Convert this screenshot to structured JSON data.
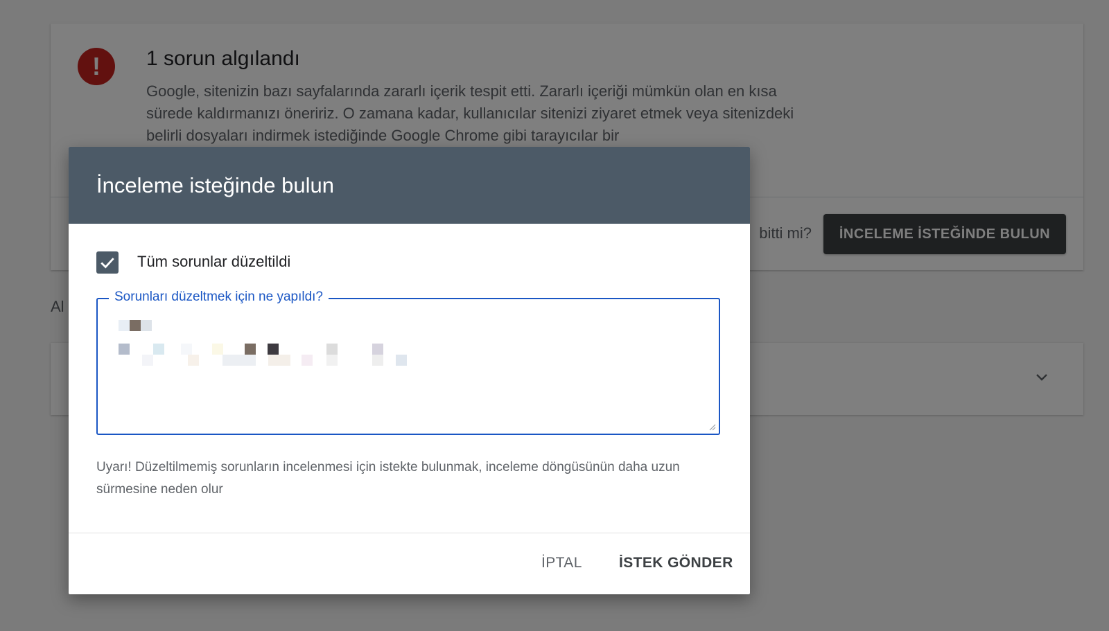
{
  "background": {
    "issue": {
      "icon": "exclamation-icon",
      "title": "1 sorun algılandı",
      "body": "Google, sitenizin bazı sayfalarında zararlı içerik tespit etti. Zararlı içeriği mümkün olan en kısa sürede kaldırmanızı öneririz. O zamana kadar, kullanıcılar sitenizi ziyaret etmek veya sitenizdeki belirli dosyaları indirmek istediğinde Google Chrome gibi tarayıcılar bir",
      "question_partial": "bitti mi?",
      "request_review_label": "İNCELEME İSTEĞİNDE BULUN"
    },
    "section_label_partial": "Al",
    "detected_card": {
      "chevron_icon": "chevron-down-icon"
    }
  },
  "dialog": {
    "title": "İnceleme isteğinde bulun",
    "checkbox": {
      "label": "Tüm sorunlar düzeltildi",
      "checked": true,
      "icon": "check-icon"
    },
    "field": {
      "label": "Sorunları düzeltmek için ne yapıldı?",
      "value": ""
    },
    "warning": "Uyarı! Düzeltilmemiş sorunların incelenmesi için istekte bulunmak, inceleme döngüsünün daha uzun sürmesine neden olur",
    "buttons": {
      "cancel": "İPTAL",
      "submit": "İSTEK GÖNDER"
    }
  },
  "colors": {
    "dialog_header": "#4c5a67",
    "field_accent": "#1a56c4",
    "error_red": "#c5221f",
    "dark_button": "#3c4043"
  }
}
